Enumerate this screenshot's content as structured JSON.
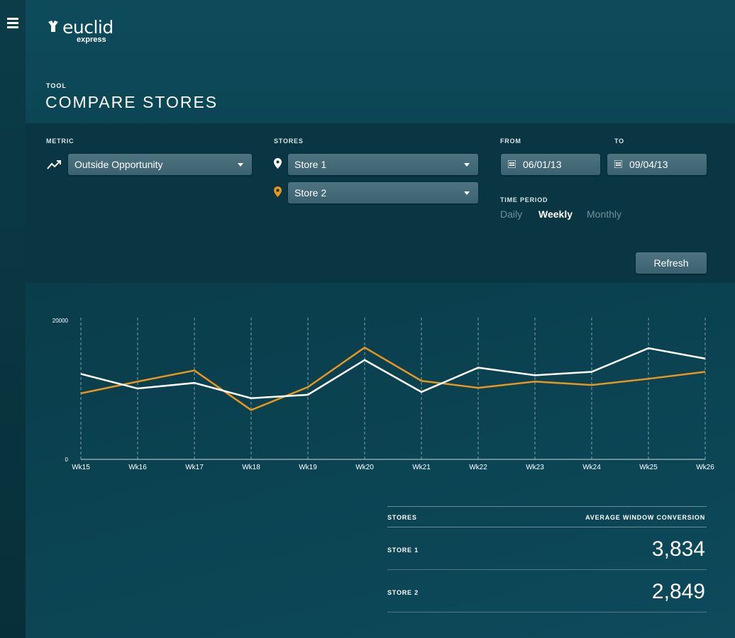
{
  "app": {
    "logo_word": "euclid",
    "logo_sub": "express",
    "icons": {
      "menu": "hamburger-icon",
      "logo": "euclid-logo-icon"
    }
  },
  "page": {
    "section_label": "TOOL",
    "title": "COMPARE STORES"
  },
  "controls": {
    "metric_label": "METRIC",
    "metric_value": "Outside Opportunity",
    "metric_icon": "trend-up-icon",
    "stores_label": "STORES",
    "store_1": "Store 1",
    "store_2": "Store 2",
    "store_1_color": "#ffffff",
    "store_2_color": "#e8961e",
    "from_label": "FROM",
    "to_label": "TO",
    "from_value": "06/01/13",
    "to_value": "09/04/13",
    "time_period_label": "TIME PERIOD",
    "periods": [
      "Daily",
      "Weekly",
      "Monthly"
    ],
    "selected_period": "Weekly",
    "refresh_label": "Refresh"
  },
  "chart_data": {
    "type": "line",
    "categories": [
      "Wk15",
      "Wk16",
      "Wk17",
      "Wk18",
      "Wk19",
      "Wk20",
      "Wk21",
      "Wk22",
      "Wk23",
      "Wk24",
      "Wk25",
      "Wk26"
    ],
    "ylim": [
      0,
      20000
    ],
    "y_ticks": [
      "0",
      "20000"
    ],
    "grid": "vertical-dashed",
    "series": [
      {
        "color": "#ffffff",
        "values": [
          12300,
          10200,
          11000,
          8800,
          9300,
          14300,
          9700,
          13200,
          12100,
          12600,
          16000,
          14500
        ]
      },
      {
        "color": "#e8961e",
        "values": [
          9500,
          11200,
          12800,
          7100,
          10400,
          16100,
          11300,
          10300,
          11200,
          10700,
          11600,
          12600
        ]
      }
    ]
  },
  "summary": {
    "col_stores": "STORES",
    "col_metric": "AVERAGE WINDOW CONVERSION",
    "rows": [
      {
        "name": "STORE 1",
        "value": "3,834"
      },
      {
        "name": "STORE 2",
        "value": "2,849"
      }
    ]
  }
}
